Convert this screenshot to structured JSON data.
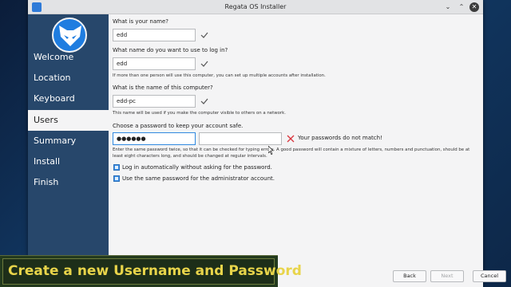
{
  "window": {
    "title": "Regata OS Installer"
  },
  "sidebar": {
    "items": [
      {
        "label": "Welcome",
        "active": false
      },
      {
        "label": "Location",
        "active": false
      },
      {
        "label": "Keyboard",
        "active": false
      },
      {
        "label": "Users",
        "active": true
      },
      {
        "label": "Summary",
        "active": false
      },
      {
        "label": "Install",
        "active": false
      },
      {
        "label": "Finish",
        "active": false
      }
    ]
  },
  "form": {
    "name_label": "What is your name?",
    "name_value": "edd",
    "login_label": "What name do you want to use to log in?",
    "login_value": "edd",
    "login_hint": "If more than one person will use this computer, you can set up multiple accounts after installation.",
    "computer_label": "What is the name of this computer?",
    "computer_value": "edd-pc",
    "computer_hint": "This name will be used if you make the computer visible to others on a network.",
    "password_label": "Choose a password to keep your account safe.",
    "password_value": "●●●●●●",
    "password_confirm_value": "",
    "password_error": "Your passwords do not match!",
    "password_hint": "Enter the same password twice, so that it can be checked for typing errors. A good password will contain a mixture of letters, numbers and punctuation, should be at least eight characters long, and should be changed at regular intervals.",
    "autologin_label": "Log in automatically without asking for the password.",
    "autologin_checked": true,
    "admin_same_label": "Use the same password for the administrator account.",
    "admin_same_checked": true
  },
  "buttons": {
    "back": "Back",
    "next": "Next",
    "cancel": "Cancel"
  },
  "overlay": {
    "caption": "Create a new Username and Password"
  },
  "colors": {
    "sidebar": "#27476b",
    "accent": "#2f88e0",
    "banner_text": "#e8d44a"
  }
}
